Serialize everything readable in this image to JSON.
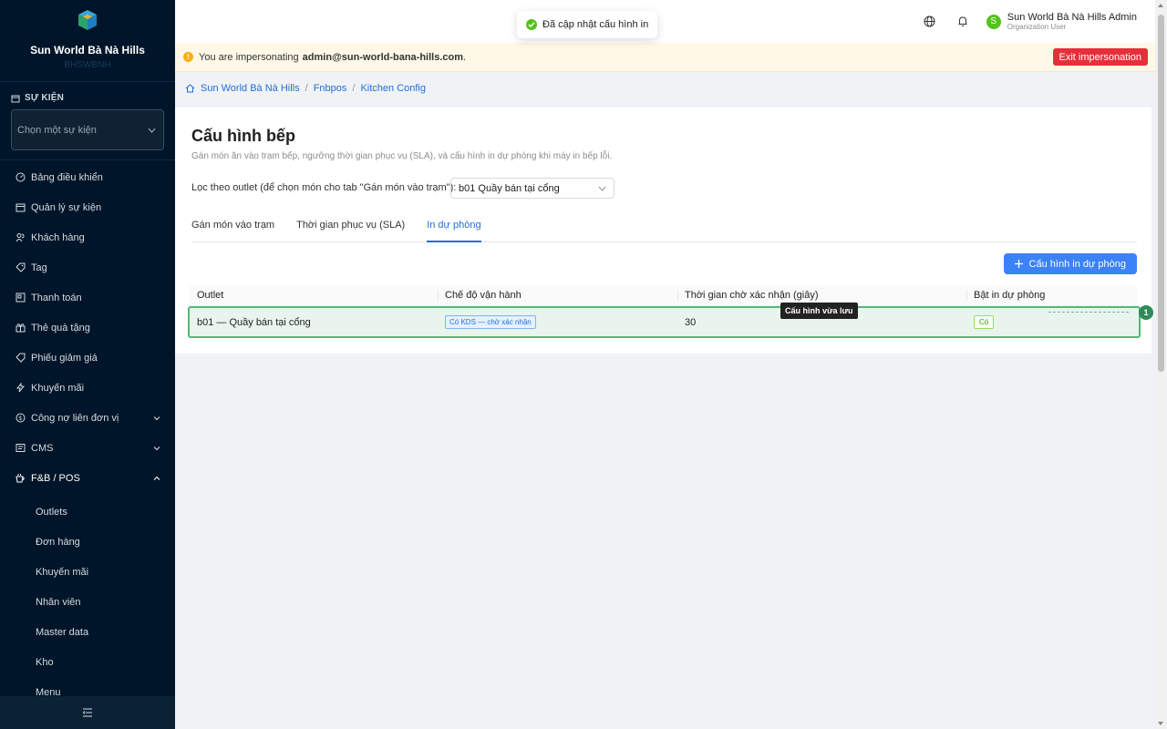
{
  "sidebar": {
    "brand_name": "Sun World Bà Nà Hills",
    "brand_sub": "BHSWBNH",
    "event_heading": "SỰ KIỆN",
    "event_placeholder": "Chọn một sự kiện",
    "items": [
      {
        "label": "Bảng điều khiển",
        "icon": "dashboard-icon"
      },
      {
        "label": "Quản lý sự kiện",
        "icon": "calendar-icon"
      },
      {
        "label": "Khách hàng",
        "icon": "users-icon"
      },
      {
        "label": "Tag",
        "icon": "tag-icon"
      },
      {
        "label": "Thanh toán",
        "icon": "payment-icon"
      },
      {
        "label": "Thẻ quà tặng",
        "icon": "gift-icon"
      },
      {
        "label": "Phiếu giảm giá",
        "icon": "coupon-icon"
      },
      {
        "label": "Khuyến mãi",
        "icon": "promotion-icon"
      },
      {
        "label": "Công nợ liên đơn vị",
        "icon": "debt-icon"
      },
      {
        "label": "CMS",
        "icon": "cms-icon"
      },
      {
        "label": "F&B / POS",
        "icon": "coffee-icon"
      }
    ],
    "sub_items": [
      "Outlets",
      "Đơn hàng",
      "Khuyến mãi",
      "Nhân viên",
      "Master data",
      "Kho",
      "Menu"
    ]
  },
  "toast": {
    "message": "Đã cập nhật cấu hình in"
  },
  "user": {
    "name": "Sun World Bà Nà Hills Admin",
    "role": "Organization User",
    "avatar_letter": "S"
  },
  "impersonation": {
    "prefix": "You are impersonating",
    "email": "admin@sun-world-bana-hills.com",
    "suffix": ".",
    "exit_label": "Exit impersonation"
  },
  "breadcrumb": {
    "home": "Sun World Bà Nà Hills",
    "section": "Fnbpos",
    "page": "Kitchen Config",
    "sep": "/"
  },
  "page": {
    "title": "Cấu hình bếp",
    "description": "Gán món ăn vào trạm bếp, ngưỡng thời gian phục vụ (SLA), và cấu hình in dự phòng khi máy in bếp lỗi.",
    "filter_label": "Lọc theo outlet (để chọn món cho tab \"Gán món vào trạm\"):",
    "filter_value": "b01 Quầy bán tại cổng",
    "tabs": [
      "Gán món vào trạm",
      "Thời gian phục vụ (SLA)",
      "In dự phòng"
    ],
    "active_tab": 2,
    "add_button": "Cấu hình in dự phòng"
  },
  "table": {
    "columns": [
      "Outlet",
      "Chế độ vận hành",
      "Thời gian chờ xác nhận (giây)",
      "Bật in dự phòng"
    ],
    "rows": [
      {
        "outlet": "b01 — Quầy bán tại cổng",
        "mode": "Có KDS — chờ xác nhận",
        "timeout": "30",
        "enabled": "Có"
      }
    ]
  },
  "annotation": {
    "tooltip": "Cấu hình vừa lưu",
    "badge": "1"
  },
  "colors": {
    "sidebar_bg": "#001529",
    "primary": "#3b82f6",
    "danger": "#e5303a",
    "success": "#52c41a",
    "highlight_border": "#54b879"
  }
}
